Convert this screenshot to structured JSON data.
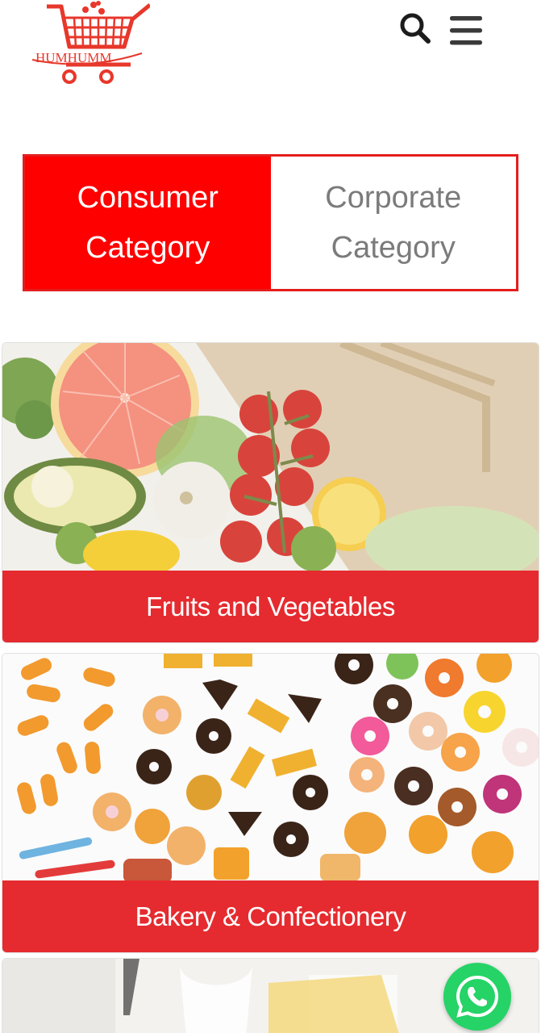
{
  "header": {
    "logo_text": "HUMHUMM",
    "search_icon": "search-icon",
    "menu_icon": "hamburger-menu-icon"
  },
  "category_tabs": [
    {
      "line1": "Consumer",
      "line2": "Category",
      "active": true
    },
    {
      "line1": "Corporate",
      "line2": "Category",
      "active": false
    }
  ],
  "categories": [
    {
      "label": "Fruits and Vegetables",
      "image": "fruits-vegetables-photo"
    },
    {
      "label": "Bakery & Confectionery",
      "image": "bakery-confectionery-photo"
    },
    {
      "label": "",
      "image": "dairy-photo"
    }
  ],
  "floating": {
    "whatsapp_icon": "whatsapp-icon"
  },
  "colors": {
    "brand_red": "#e52b2f",
    "active_tab": "#fe0000",
    "whatsapp_green": "#25d366"
  }
}
